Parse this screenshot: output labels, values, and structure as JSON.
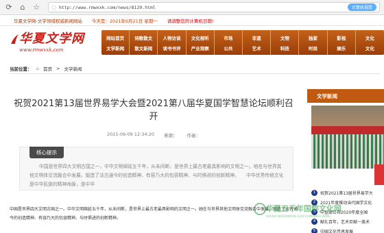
{
  "browser": {
    "url": "http://www.rmwxxk.com/news/8129.html",
    "ai_button": "计算机视觉"
  },
  "topstrip": {
    "site": "华夏文学网-文学领域权威新闻网站",
    "date": "今天是：2021年6月21日 星期一",
    "notice": "请调整您的计算机日期!"
  },
  "logo": {
    "title": "华夏文学网",
    "url": "www.rmwxxk.com"
  },
  "nav": [
    [
      "网站首页",
      "文学新闻"
    ],
    [
      "诗歌散文",
      "散文新闻"
    ],
    [
      "人物访谈",
      "读书书评"
    ],
    [
      "文化视听",
      "产业观察"
    ],
    [
      "市场",
      "公共"
    ],
    [
      "非遗",
      "艺术"
    ],
    [
      "文物",
      "科技"
    ],
    [
      "独家",
      "时尚"
    ],
    [
      "影视",
      "娱乐"
    ],
    [
      "文化",
      "文化"
    ]
  ],
  "breadcrumb": {
    "label": "当前位置：",
    "home": "首页",
    "sep": ">",
    "section": "文学新闻"
  },
  "article": {
    "title": "祝贺2021第13届世界易学大会暨2021第八届华夏国学智慧论坛顺利召开",
    "date": "2021-06-09 12:34:20",
    "source": "来源：",
    "author": "作者：",
    "key_title": "核心提示",
    "key_text": "中国是世界四大文明古国之一，中华文明绵延五千年，从未间断，是世界上最古老最具影响的文明之一。地在与世界其他文明体交流融合中发展，锻造了法古通今的创造精神、有容乃大的包容精神、与时俱进的创新精神。　　中华优秀传统文化是中华民族的精神命脉，是中华",
    "body": "中国是世界四大文明古国之一。中华文明绵延五千年，从未间断，是世界上最古老最具影响的文明之一。她在与世界其他文明体交流融合中发展，锻造了法古通今的创造精神、有容乃大的包容精神、与时俱进的创新精神。"
  },
  "sidebar": {
    "heading": "文学新闻",
    "items": [
      "祝贺2021第13届世界易学大",
      "2021年度推动当代国学文化",
      "中宣部公布2020年度全国",
      "献礼百年，艺术巨献一美术",
      "中国文化传承发展"
    ]
  },
  "watermark": {
    "cn": "华夏五千年国粹文化网",
    "en": "HUAXIA WUQIANNIAN GUOCUI WENHUA WANG"
  },
  "colors": {
    "nav_bg": "#b0501a",
    "sidebar_head": "#c05a10",
    "logo": "#c8201a"
  }
}
